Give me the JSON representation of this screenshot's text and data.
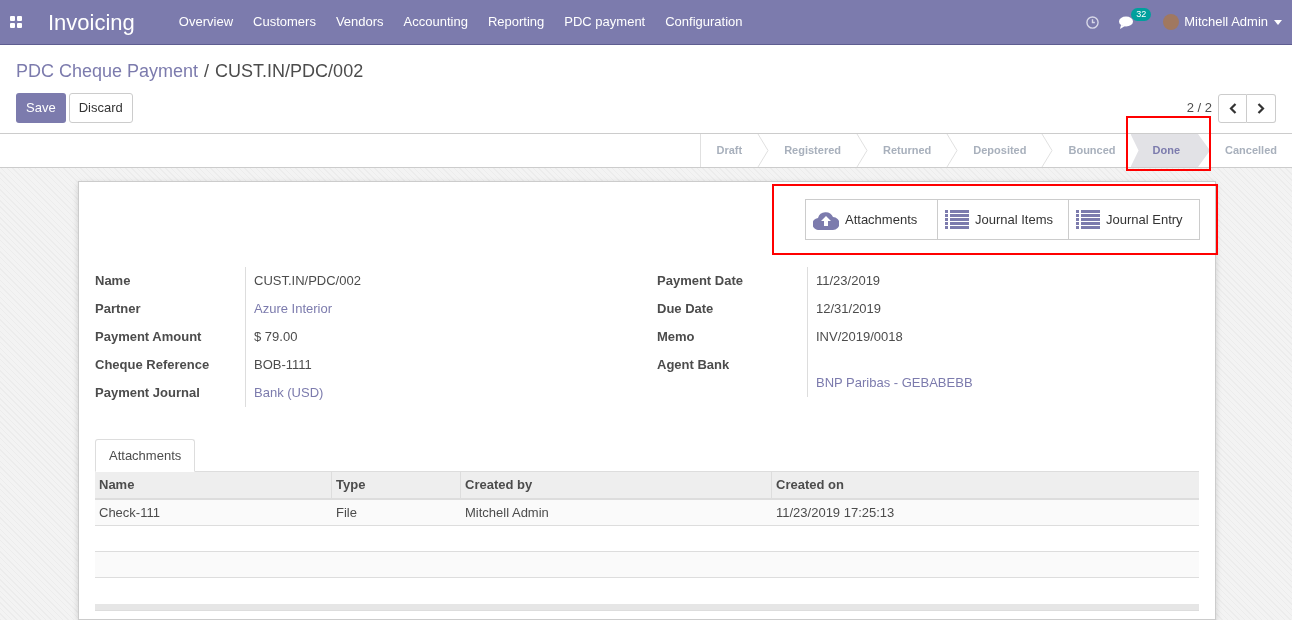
{
  "navbar": {
    "app_title": "Invoicing",
    "menu": [
      "Overview",
      "Customers",
      "Vendors",
      "Accounting",
      "Reporting",
      "PDC payment",
      "Configuration"
    ],
    "messages_badge": "32",
    "user": "Mitchell Admin"
  },
  "breadcrumb": {
    "parent": "PDC Cheque Payment",
    "separator": "/",
    "current": "CUST.IN/PDC/002"
  },
  "buttons": {
    "save": "Save",
    "discard": "Discard"
  },
  "pager": "2 / 2",
  "stages": [
    {
      "label": "Draft",
      "selected": false
    },
    {
      "label": "Registered",
      "selected": false
    },
    {
      "label": "Returned",
      "selected": false
    },
    {
      "label": "Deposited",
      "selected": false
    },
    {
      "label": "Bounced",
      "selected": false
    },
    {
      "label": "Done",
      "selected": true
    },
    {
      "label": "Cancelled",
      "selected": false
    }
  ],
  "smart_buttons": [
    {
      "kind": "cloud",
      "label": "Attachments"
    },
    {
      "kind": "list",
      "label": "Journal Items"
    },
    {
      "kind": "list",
      "label": "Journal Entry"
    }
  ],
  "left_fields": [
    {
      "label": "Name",
      "value": "CUST.IN/PDC/002",
      "kind": "text"
    },
    {
      "label": "Partner",
      "value": "Azure Interior",
      "kind": "link"
    },
    {
      "label": "Payment Amount",
      "value": "$ 79.00",
      "kind": "text"
    },
    {
      "label": "Cheque Reference",
      "value": "BOB-1111",
      "kind": "text"
    },
    {
      "label": "Payment Journal",
      "value": "Bank (USD)",
      "kind": "link"
    }
  ],
  "right_fields": [
    {
      "label": "Payment Date",
      "value": "11/23/2019",
      "kind": "text"
    },
    {
      "label": "Due Date",
      "value": "12/31/2019",
      "kind": "text"
    },
    {
      "label": "Memo",
      "value": "INV/2019/0018",
      "kind": "text"
    },
    {
      "label": "Agent Bank",
      "value": "BNP Paribas - GEBABEBB",
      "kind": "link"
    }
  ],
  "notebook_tabs": [
    {
      "label": "Attachments",
      "selected": true
    }
  ],
  "table": {
    "columns": [
      "Name",
      "Type",
      "Created by",
      "Created on"
    ],
    "rows": [
      [
        "Check-111",
        "File",
        "Mitchell Admin",
        "11/23/2019 17:25:13"
      ]
    ]
  }
}
